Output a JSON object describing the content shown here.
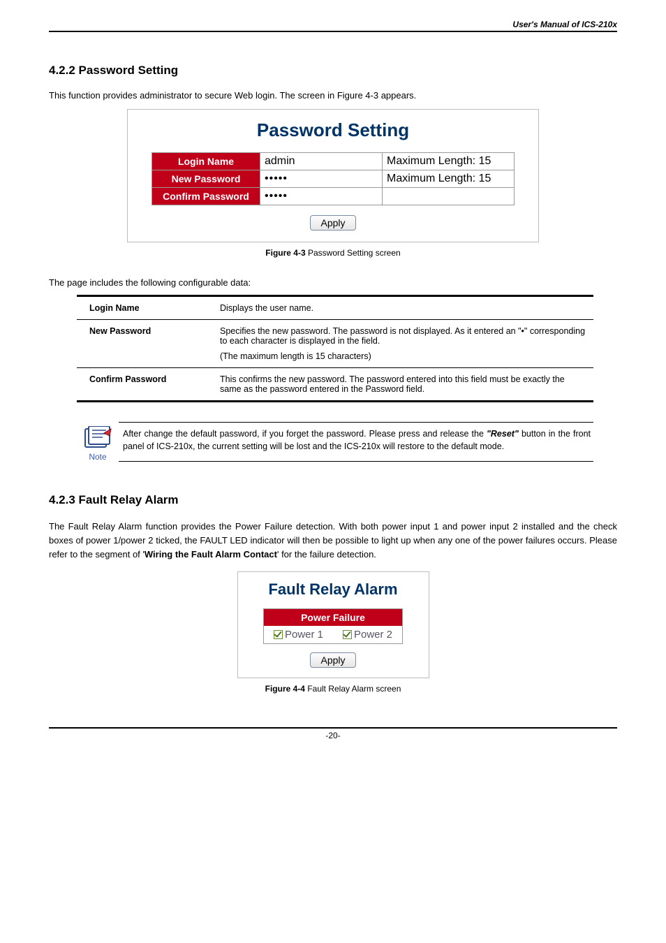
{
  "header": {
    "title": "User's Manual of ICS-210x"
  },
  "s1": {
    "heading": "4.2.2 Password Setting",
    "intro": "This function provides administrator to secure Web login. The screen in Figure 4-3 appears.",
    "ss": {
      "title": "Password Setting",
      "rows": {
        "login": {
          "label": "Login Name",
          "value": "admin",
          "hint": "Maximum Length: 15"
        },
        "newpw": {
          "label": "New Password",
          "value": "•••••",
          "hint": "Maximum Length: 15"
        },
        "confirm": {
          "label": "Confirm Password",
          "value": "•••••"
        }
      },
      "apply": "Apply"
    },
    "fig": {
      "b": "Figure 4-3",
      "t": " Password Setting screen"
    },
    "cfg_intro": "The page includes the following configurable data:",
    "cfg": {
      "login": {
        "k": "Login Name",
        "v": "Displays the user name."
      },
      "newpw": {
        "k": "New Password",
        "v1": "Specifies the new password. The password is not displayed. As it entered an \"•\" corresponding to each character is displayed in the field.",
        "v2": "(The maximum length is 15 characters)"
      },
      "confirm": {
        "k": "Confirm Password",
        "v": "This confirms the new password. The password entered into this field must be exactly the same as the password entered in the Password field."
      }
    },
    "note": {
      "label": "Note",
      "t1": "After change the default password, if you forget the password. Please press and release the ",
      "tb": "\"Reset\"",
      "t2": " button in the front panel of ICS-210x, the current setting will be lost and the ICS-210x will restore to the default mode."
    }
  },
  "s2": {
    "heading": "4.2.3 Fault Relay Alarm",
    "p1a": "The Fault Relay Alarm function provides the Power Failure detection. With both power input 1 and power input 2 installed and the check boxes of power 1/power 2 ticked, the FAULT LED indicator will then be possible to light up when any one of the power failures occurs. Please refer to the segment of '",
    "p1b": "Wiring the Fault Alarm Contact",
    "p1c": "' for the failure detection.",
    "ss": {
      "title": "Fault Relay Alarm",
      "head": "Power Failure",
      "p1": "Power 1",
      "p2": "Power 2",
      "apply": "Apply"
    },
    "fig": {
      "b": "Figure 4-4",
      "t": " Fault Relay Alarm screen"
    }
  },
  "footer": "-20-"
}
